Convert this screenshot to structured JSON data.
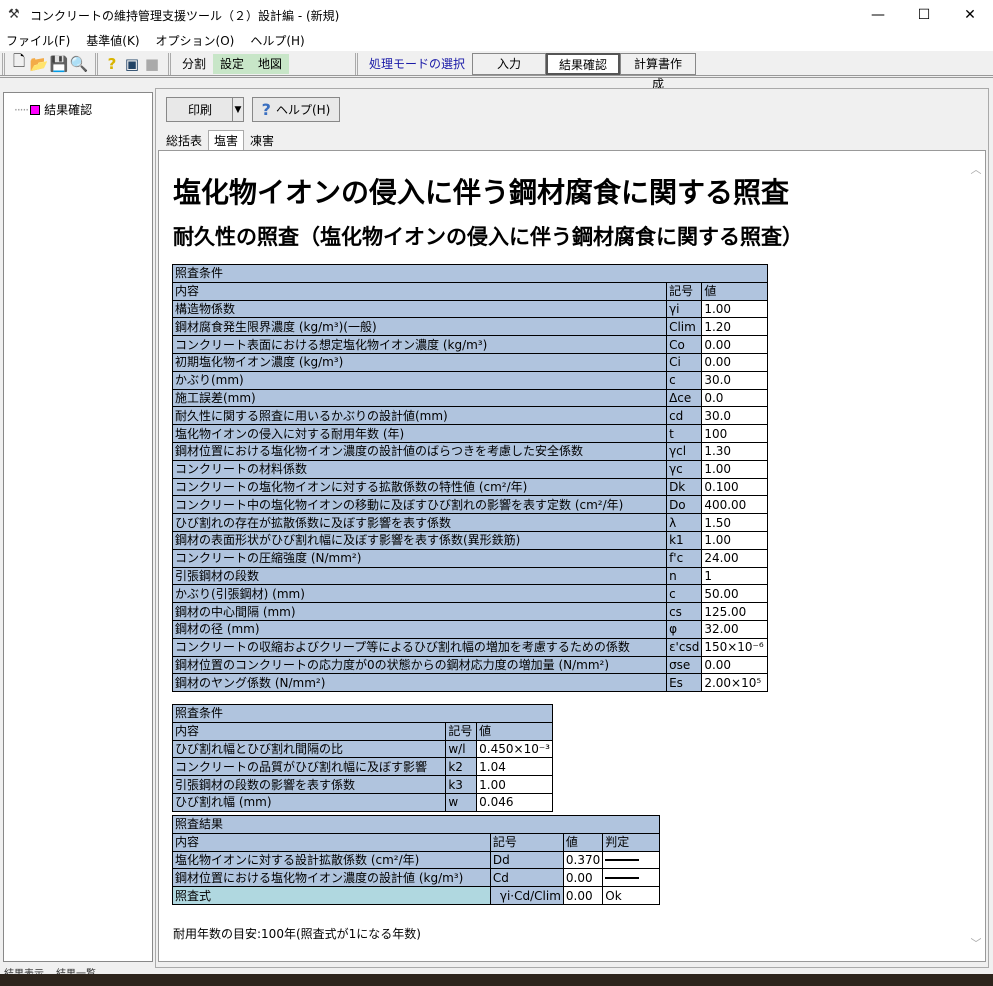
{
  "window": {
    "title": "コンクリートの維持管理支援ツール（２）設計編 - (新規)",
    "minimize": "—",
    "maximize": "☐",
    "close": "✕"
  },
  "menu": [
    "ファイル(F)",
    "基準値(K)",
    "オプション(O)",
    "ヘルプ(H)"
  ],
  "toolbar": {
    "divide": "分割",
    "settings": "設定",
    "map": "地図",
    "mode_label": "処理モードの選択",
    "modes": [
      "入力",
      "結果確認",
      "計算書作成"
    ]
  },
  "tree": {
    "item": "結果確認"
  },
  "actions": {
    "print": "印刷",
    "help": "ヘルプ(H)"
  },
  "tabs": [
    "総括表",
    "塩害",
    "凍害"
  ],
  "doc": {
    "title": "塩化物イオンの侵入に伴う鋼材腐食に関する照査",
    "subtitle": "耐久性の照査（塩化物イオンの侵入に伴う鋼材腐食に関する照査）",
    "t1": {
      "caption": "照査条件",
      "headers": [
        "内容",
        "記号",
        "値"
      ],
      "rows": [
        [
          "構造物係数",
          "γi",
          "1.00"
        ],
        [
          "鋼材腐食発生限界濃度 (kg/m³)(一般)",
          "Clim",
          "1.20"
        ],
        [
          "コンクリート表面における想定塩化物イオン濃度 (kg/m³)",
          "Co",
          "0.00"
        ],
        [
          "初期塩化物イオン濃度 (kg/m³)",
          "Ci",
          "0.00"
        ],
        [
          "かぶり(mm)",
          "c",
          "30.0"
        ],
        [
          "施工誤差(mm)",
          "Δce",
          "0.0"
        ],
        [
          "耐久性に関する照査に用いるかぶりの設計値(mm)",
          "cd",
          "30.0"
        ],
        [
          "塩化物イオンの侵入に対する耐用年数 (年)",
          "t",
          "100"
        ],
        [
          "鋼材位置における塩化物イオン濃度の設計値のばらつきを考慮した安全係数",
          "γcl",
          "1.30"
        ],
        [
          "コンクリートの材料係数",
          "γc",
          "1.00"
        ],
        [
          "コンクリートの塩化物イオンに対する拡散係数の特性値 (cm²/年)",
          "Dk",
          "0.100"
        ],
        [
          "コンクリート中の塩化物イオンの移動に及ぼすひび割れの影響を表す定数 (cm²/年)",
          "Do",
          "400.00"
        ],
        [
          "ひび割れの存在が拡散係数に及ぼす影響を表す係数",
          "λ",
          "1.50"
        ],
        [
          "鋼材の表面形状がひび割れ幅に及ぼす影響を表す係数(異形鉄筋)",
          "k1",
          "1.00"
        ],
        [
          "コンクリートの圧縮強度 (N/mm²)",
          "f'c",
          "24.00"
        ],
        [
          "引張鋼材の段数",
          "n",
          "1"
        ],
        [
          "かぶり(引張鋼材) (mm)",
          "c",
          "50.00"
        ],
        [
          "鋼材の中心間隔 (mm)",
          "cs",
          "125.00"
        ],
        [
          "鋼材の径 (mm)",
          "φ",
          "32.00"
        ],
        [
          "コンクリートの収縮およびクリープ等によるひび割れ幅の増加を考慮するための係数",
          "ε'csd",
          "150×10⁻⁶"
        ],
        [
          "鋼材位置のコンクリートの応力度が0の状態からの鋼材応力度の増加量 (N/mm²)",
          "σse",
          "0.00"
        ],
        [
          "鋼材のヤング係数 (N/mm²)",
          "Es",
          "2.00×10⁵"
        ]
      ]
    },
    "t2": {
      "caption": "照査条件",
      "headers": [
        "内容",
        "記号",
        "値"
      ],
      "rows": [
        [
          "ひび割れ幅とひび割れ間隔の比",
          "w/l",
          "0.450×10⁻³"
        ],
        [
          "コンクリートの品質がひび割れ幅に及ぼす影響",
          "k2",
          "1.04"
        ],
        [
          "引張鋼材の段数の影響を表す係数",
          "k3",
          "1.00"
        ],
        [
          "ひび割れ幅 (mm)",
          "w",
          "0.046"
        ]
      ]
    },
    "t3": {
      "caption": "照査結果",
      "headers": [
        "内容",
        "記号",
        "値",
        "判定"
      ],
      "rows": [
        [
          "塩化物イオンに対する設計拡散係数 (cm²/年)",
          "Dd",
          "0.370",
          ""
        ],
        [
          "鋼材位置における塩化物イオン濃度の設計値 (kg/m³)",
          "Cd",
          "0.00",
          ""
        ]
      ],
      "formula": {
        "label": "照査式",
        "symbol": "γi·Cd/Clim",
        "value": "0.00",
        "judge": "Ok"
      }
    },
    "note": "耐用年数の目安:100年(照査式が1になる年数)"
  },
  "status": [
    "結果表示",
    "結果一覧"
  ]
}
